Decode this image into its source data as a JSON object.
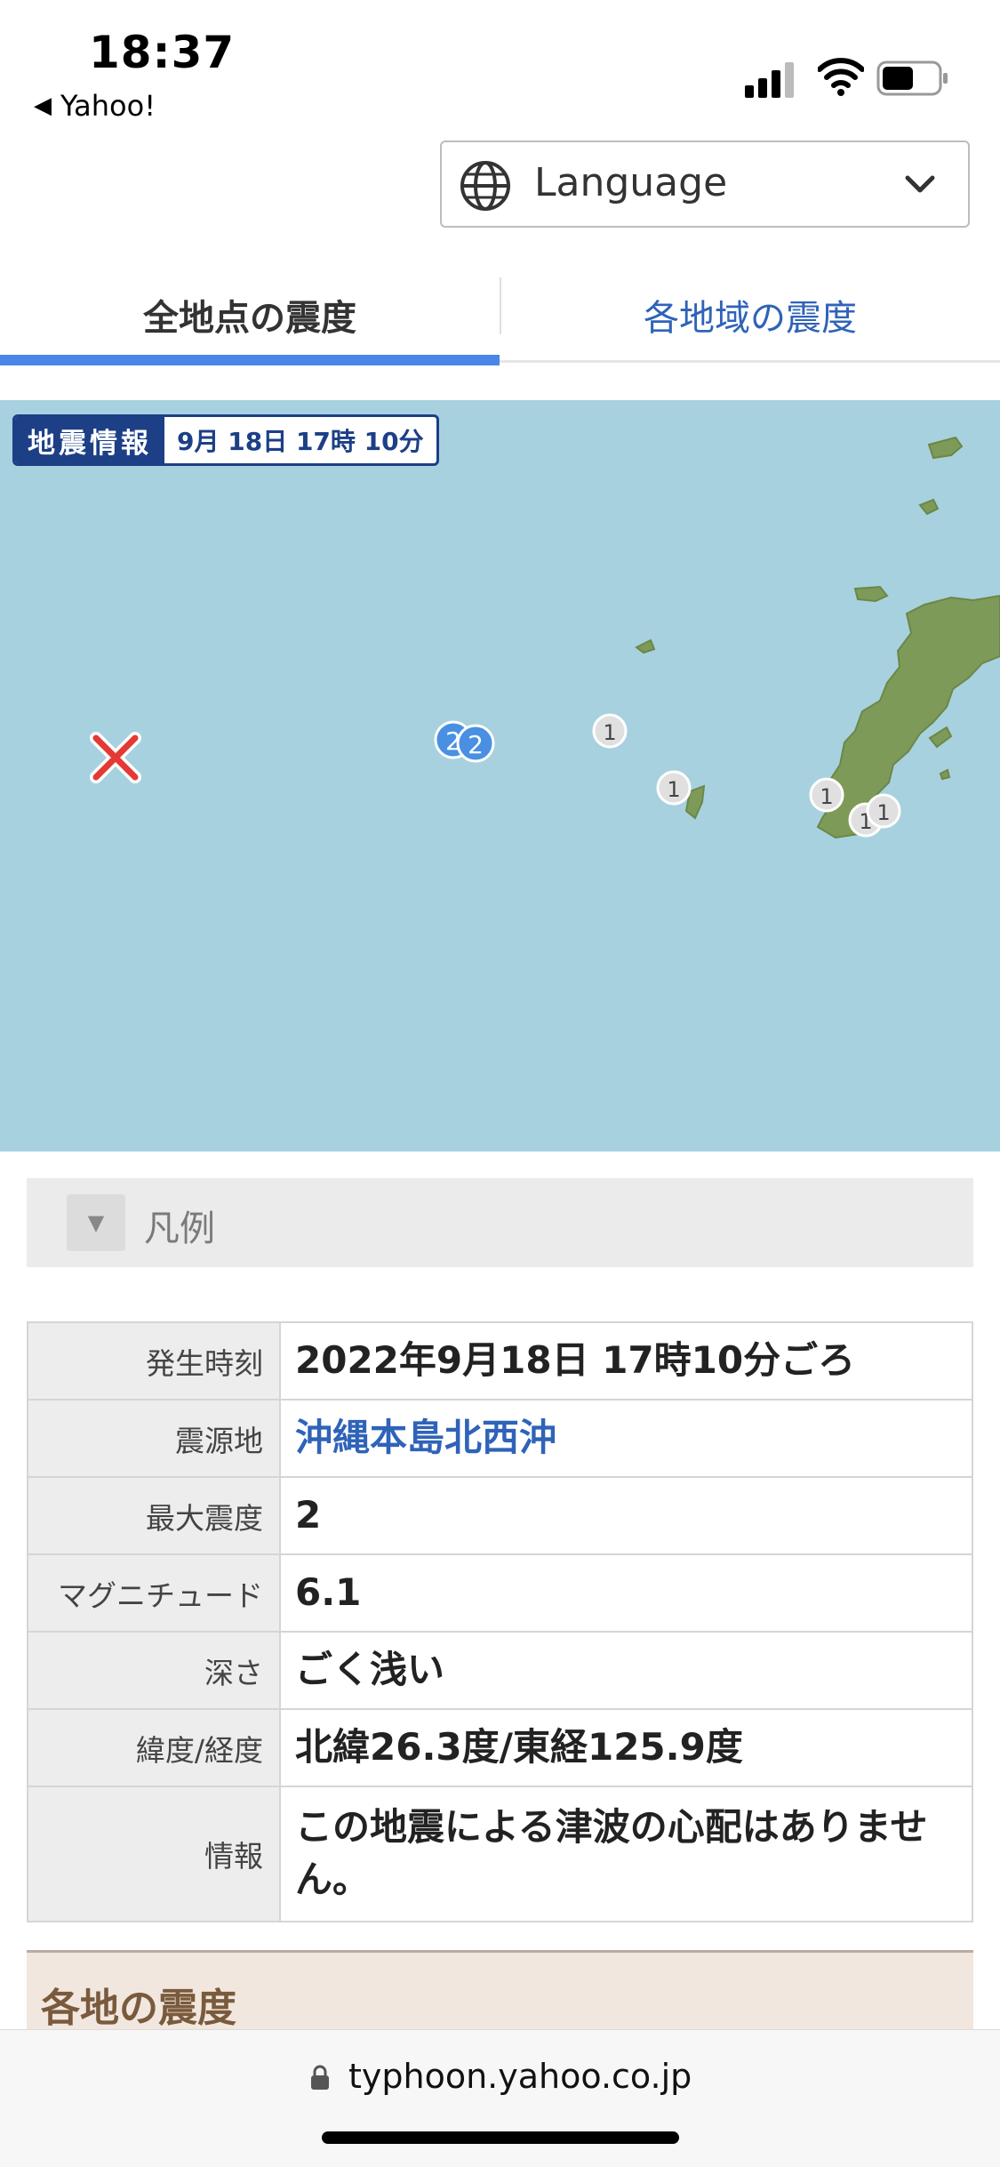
{
  "status_bar": {
    "time": "18:37",
    "back_app": "Yahoo!",
    "icons": [
      "signal-icon",
      "wifi-icon",
      "battery-icon"
    ]
  },
  "language_select": {
    "label": "Language",
    "icon": "globe-icon"
  },
  "tabs": [
    {
      "label": "全地点の震度",
      "active": true
    },
    {
      "label": "各地域の震度",
      "active": false
    }
  ],
  "map": {
    "tag_label": "地震情報",
    "tag_time": "9月 18日 17時 10分",
    "epicenter_icon": "epicenter-x-icon",
    "intensity_markers": [
      {
        "value": "2",
        "color": "#4a90e2"
      },
      {
        "value": "2",
        "color": "#4a90e2"
      },
      {
        "value": "1",
        "color": "#e0e0e0"
      },
      {
        "value": "1",
        "color": "#e0e0e0"
      },
      {
        "value": "1",
        "color": "#e0e0e0"
      },
      {
        "value": "1",
        "color": "#e0e0e0"
      },
      {
        "value": "1",
        "color": "#e0e0e0"
      }
    ],
    "colors": {
      "sea": "#a8d1df",
      "land": "#7e9a58",
      "epicenter": "#e53935"
    }
  },
  "legend": {
    "label": "凡例",
    "toggle_icon": "triangle-down-icon"
  },
  "info": {
    "rows": [
      {
        "label": "発生時刻",
        "value": "2022年9月18日 17時10分ごろ"
      },
      {
        "label": "震源地",
        "value": "沖縄本島北西沖"
      },
      {
        "label": "最大震度",
        "value": "2"
      },
      {
        "label": "マグニチュード",
        "value": "6.1"
      },
      {
        "label": "深さ",
        "value": "ごく浅い"
      },
      {
        "label": "緯度/経度",
        "value": "北緯26.3度/東経125.9度"
      },
      {
        "label": "情報",
        "value": "この地震による津波の心配はありません。"
      }
    ]
  },
  "section": {
    "title": "各地の震度"
  },
  "browser": {
    "url": "typhoon.yahoo.co.jp",
    "lock_icon": "lock-icon"
  }
}
